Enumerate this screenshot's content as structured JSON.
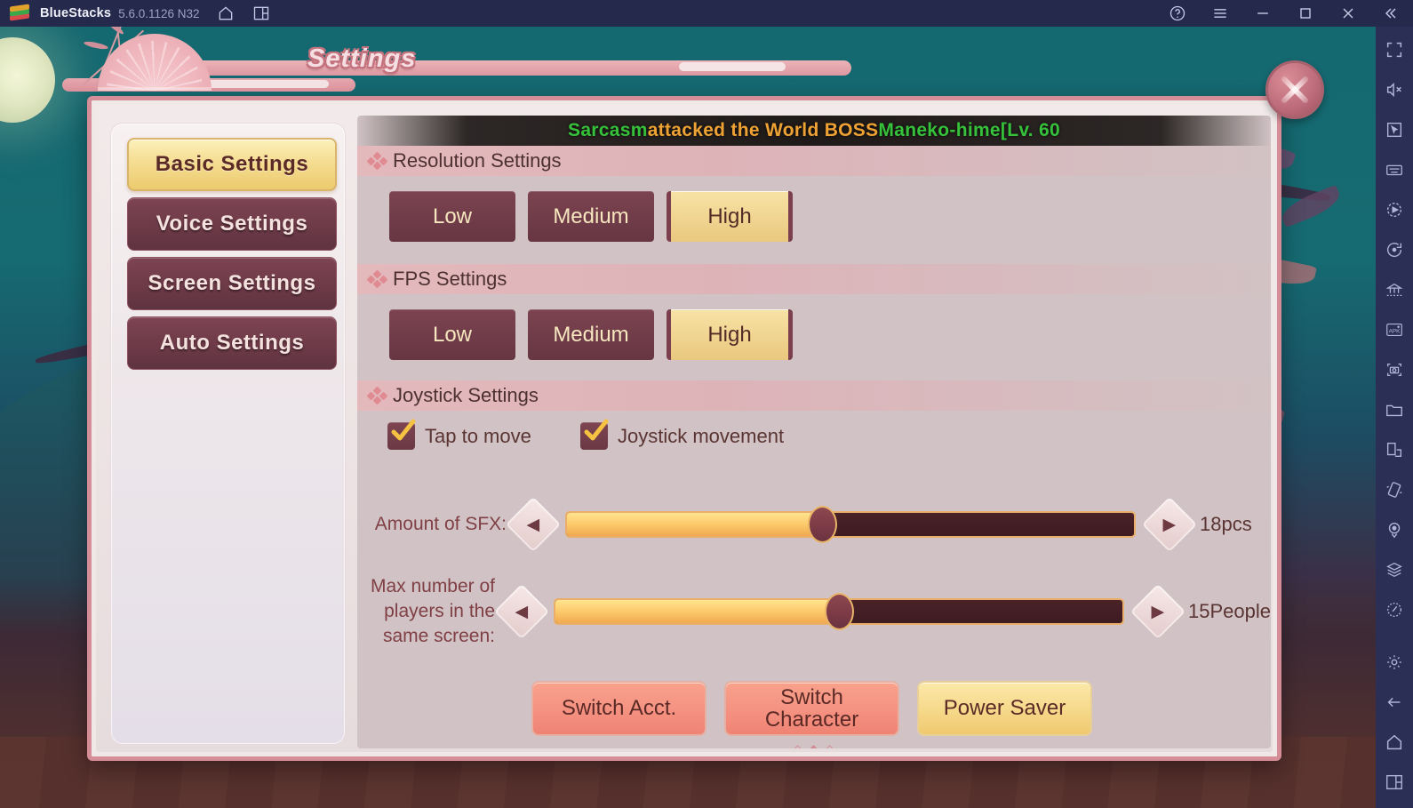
{
  "titlebar": {
    "app_name": "BlueStacks",
    "version": "5.6.0.1126 N32",
    "icons": {
      "home": "home-icon",
      "multi_instance": "multi-instance-icon",
      "help": "help-icon",
      "menu": "menu-icon",
      "minimize": "minimize-icon",
      "maximize": "maximize-icon",
      "close": "close-icon",
      "collapse": "collapse-icon"
    }
  },
  "sidebar": {
    "items": [
      {
        "name": "fullscreen-icon",
        "label": "Fullscreen"
      },
      {
        "name": "mute-icon",
        "label": "Mute"
      },
      {
        "name": "cursor-icon",
        "label": "Cursor"
      },
      {
        "name": "keyboard-icon",
        "label": "Game controls"
      },
      {
        "name": "macro-play-icon",
        "label": "Macro recorder"
      },
      {
        "name": "rotate-icon",
        "label": "Rotate"
      },
      {
        "name": "multi-instance-manager-icon",
        "label": "Multi-instance manager"
      },
      {
        "name": "install-apk-icon",
        "label": "Install APK"
      },
      {
        "name": "screenshot-icon",
        "label": "Screenshot"
      },
      {
        "name": "media-folder-icon",
        "label": "Media manager"
      },
      {
        "name": "copy-to-pc-icon",
        "label": "Copy to PC"
      },
      {
        "name": "shake-icon",
        "label": "Shake"
      },
      {
        "name": "location-icon",
        "label": "Location"
      },
      {
        "name": "layers-icon",
        "label": "Layers"
      },
      {
        "name": "eco-mode-icon",
        "label": "Eco mode"
      }
    ],
    "bottom_items": [
      {
        "name": "gear-icon",
        "label": "Settings"
      },
      {
        "name": "back-arrow-icon",
        "label": "Back"
      },
      {
        "name": "home-icon",
        "label": "Home"
      },
      {
        "name": "recent-apps-icon",
        "label": "Recent apps"
      }
    ]
  },
  "dialog": {
    "title": "Settings",
    "close_label": "Close",
    "nav": [
      {
        "label": "Basic  Settings",
        "active": true
      },
      {
        "label": "Voice  Settings",
        "active": false
      },
      {
        "label": "Screen  Settings",
        "active": false
      },
      {
        "label": "Auto  Settings",
        "active": false
      }
    ],
    "marquee": {
      "part1": "Sarcasm ",
      "part2": "attacked the World BOSS ",
      "part3": "Maneko-hime[Lv. 60",
      "color_green": "#36c13a",
      "color_orange": "#eea234"
    },
    "sections": [
      {
        "id": "resolution",
        "title": "Resolution Settings",
        "options": [
          "Low",
          "Medium",
          "High"
        ],
        "selected": "High"
      },
      {
        "id": "fps",
        "title": "FPS Settings",
        "options": [
          "Low",
          "Medium",
          "High"
        ],
        "selected": "High"
      },
      {
        "id": "joystick",
        "title": "Joystick Settings",
        "checkboxes": [
          {
            "label": "Tap to move",
            "checked": true
          },
          {
            "label": "Joystick movement",
            "checked": true
          }
        ]
      }
    ],
    "sliders": [
      {
        "id": "sfx",
        "label": "Amount of SFX:",
        "value_text": "18pcs",
        "percent": 45,
        "dec_label": "Decrease",
        "inc_label": "Increase"
      },
      {
        "id": "players",
        "label_lines": [
          "Max number of",
          "players in the",
          "same screen:"
        ],
        "value_text": "15People",
        "percent": 50,
        "dec_label": "Decrease",
        "inc_label": "Increase"
      }
    ],
    "actions": [
      {
        "label": "Switch Acct.",
        "style": "coral"
      },
      {
        "label": "Switch\nCharacter",
        "style": "coral"
      },
      {
        "label": "Power Saver",
        "style": "gold"
      }
    ]
  }
}
